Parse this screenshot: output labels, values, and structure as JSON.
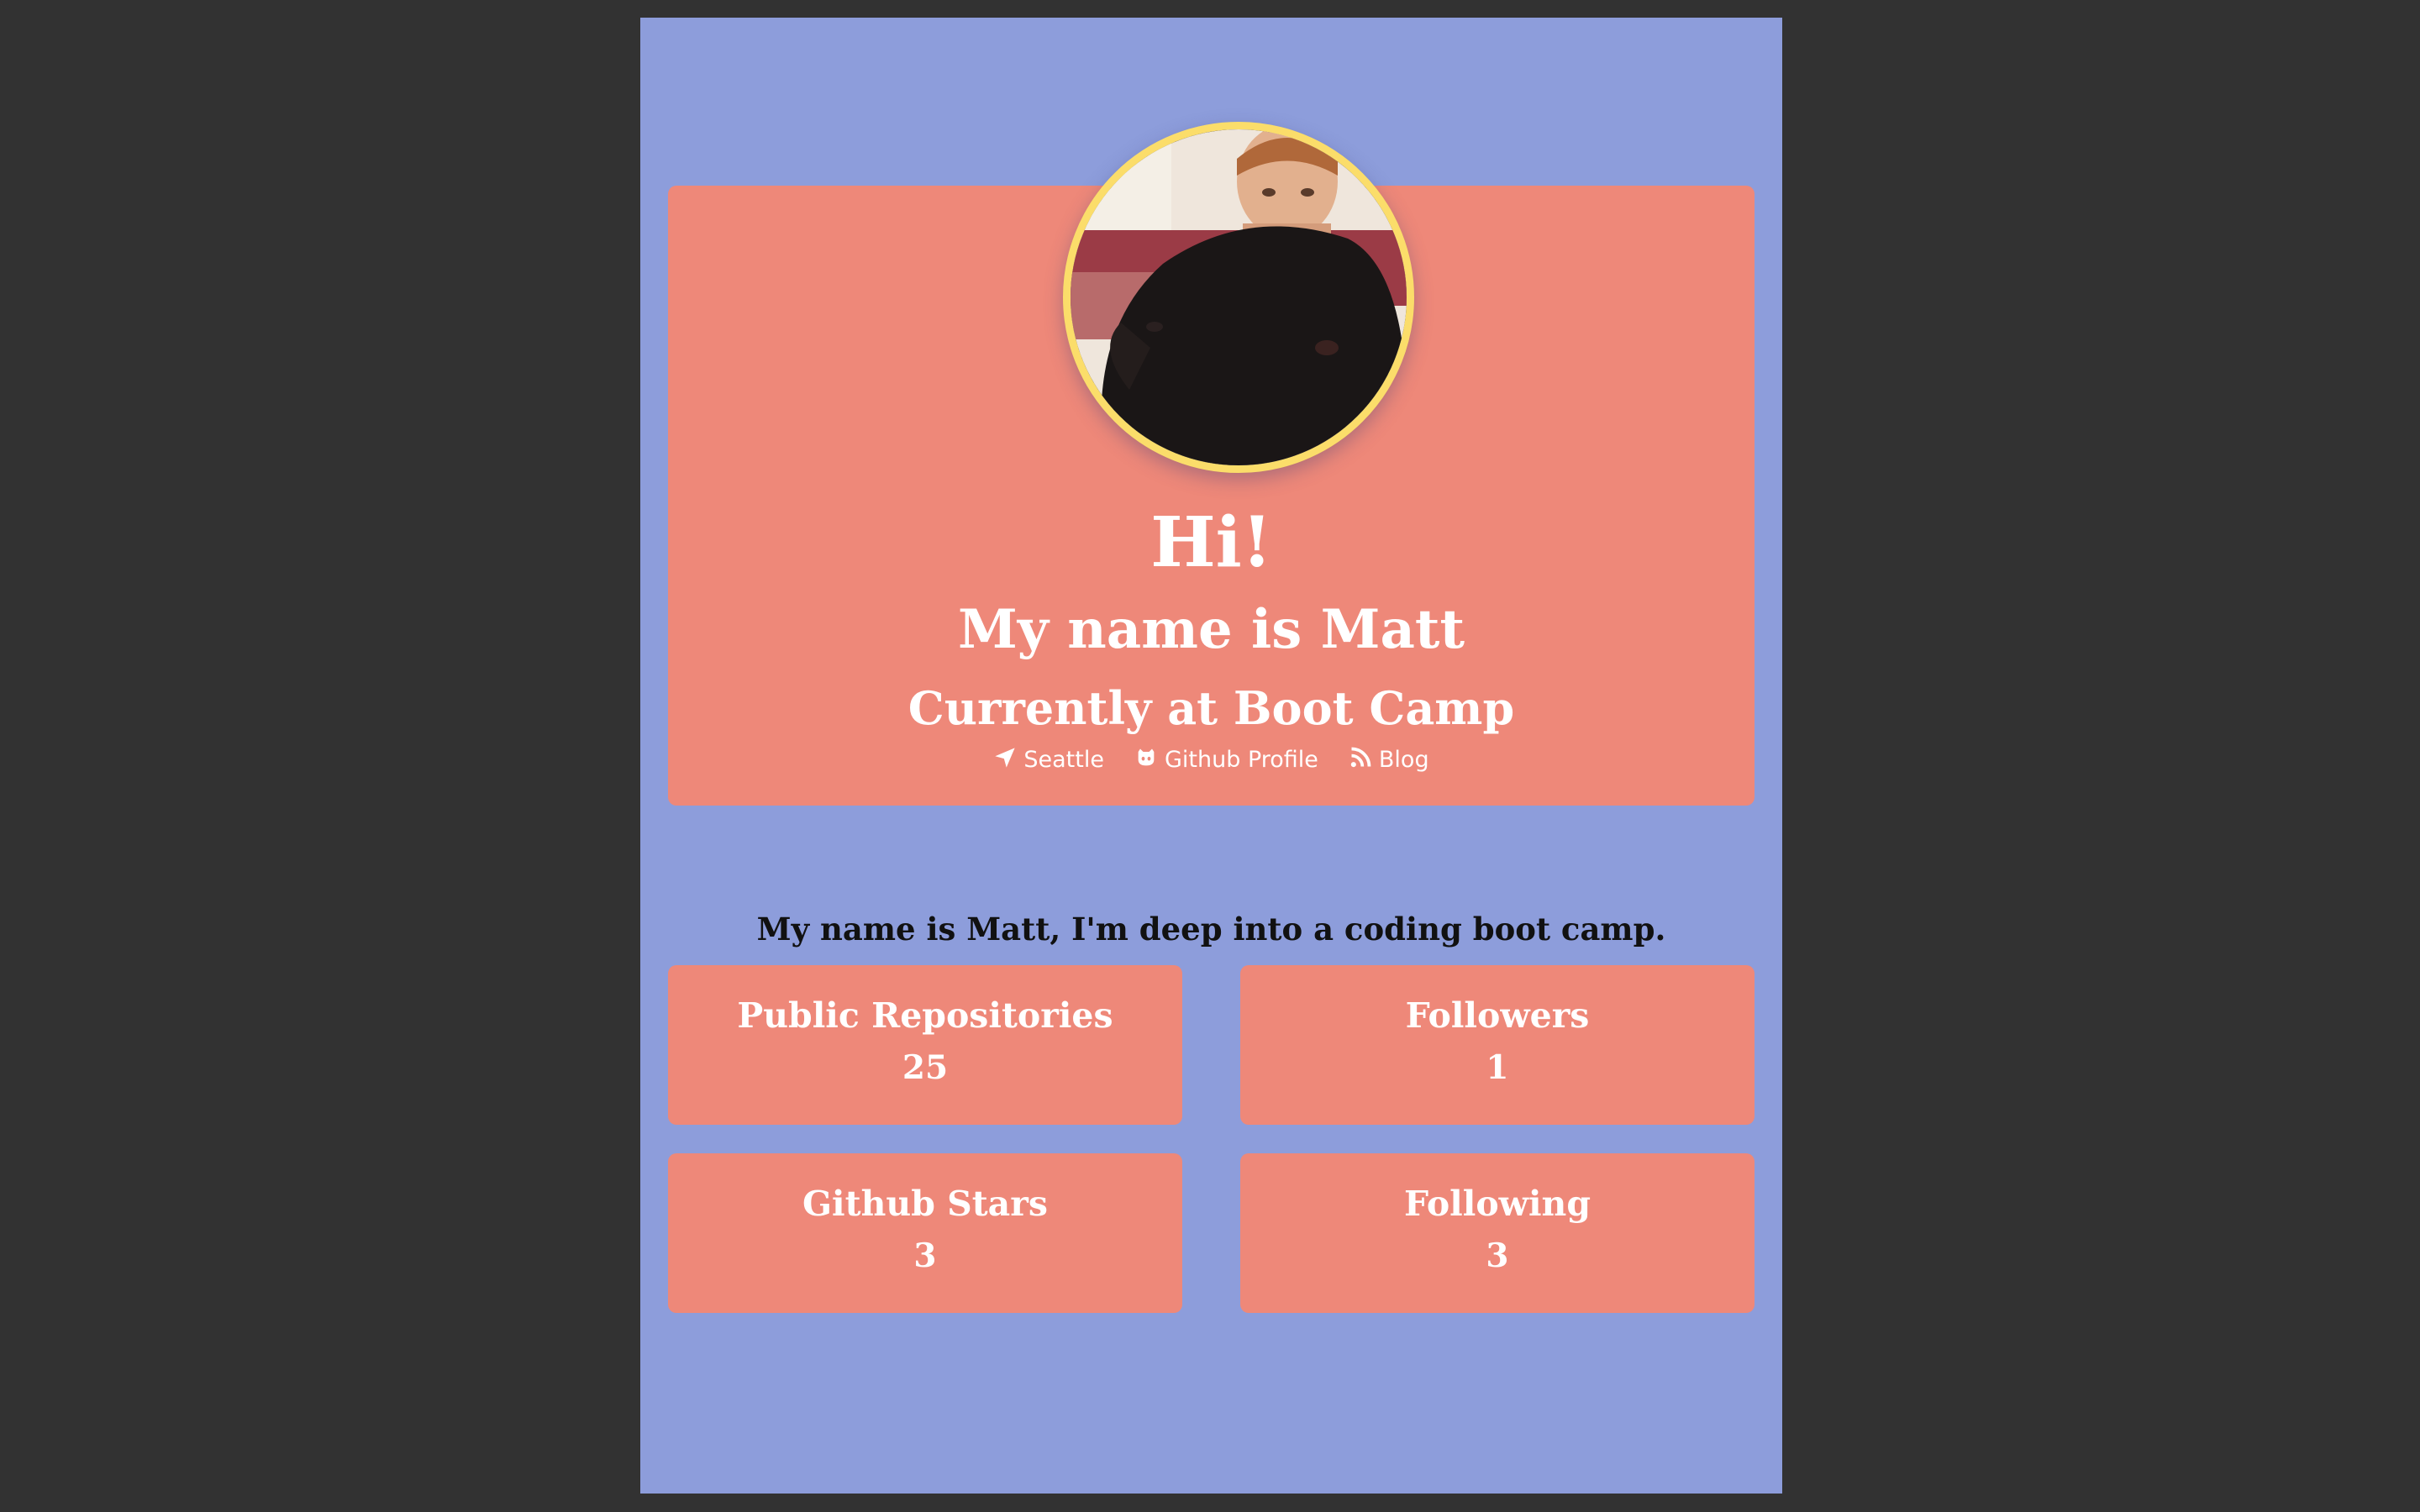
{
  "colors": {
    "backdrop": "#323232",
    "page_background": "#8d9ddb",
    "card": "#ee8879",
    "avatar_border": "#fbdd6a",
    "text_light": "#ffffff",
    "text_dark": "#111111"
  },
  "hero": {
    "greeting": "Hi!",
    "name": "My name is Matt",
    "status": "Currently at Boot Camp",
    "links": [
      {
        "label": "Seattle",
        "icon": "location-arrow-icon"
      },
      {
        "label": "Github Profile",
        "icon": "github-icon"
      },
      {
        "label": "Blog",
        "icon": "rss-icon"
      }
    ]
  },
  "bio": "My name is Matt, I'm deep into a coding boot camp.",
  "stats": [
    {
      "label": "Public Repositories",
      "value": "25"
    },
    {
      "label": "Followers",
      "value": "1"
    },
    {
      "label": "Github Stars",
      "value": "3"
    },
    {
      "label": "Following",
      "value": "3"
    }
  ]
}
